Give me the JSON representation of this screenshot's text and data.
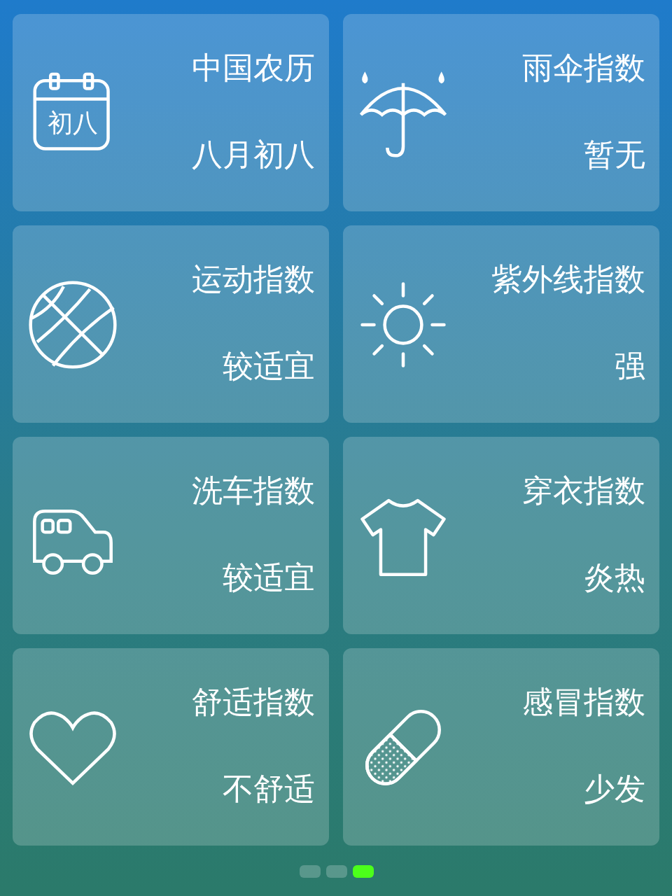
{
  "cards": [
    {
      "kind": "calendar",
      "icon_text": "初八",
      "title": "中国农历",
      "value": "八月初八"
    },
    {
      "kind": "umbrella",
      "title": "雨伞指数",
      "value": "暂无"
    },
    {
      "kind": "ball",
      "title": "运动指数",
      "value": "较适宜"
    },
    {
      "kind": "sun",
      "title": "紫外线指数",
      "value": "强"
    },
    {
      "kind": "car",
      "title": "洗车指数",
      "value": "较适宜"
    },
    {
      "kind": "shirt",
      "title": "穿衣指数",
      "value": "炎热"
    },
    {
      "kind": "heart",
      "title": "舒适指数",
      "value": "不舒适"
    },
    {
      "kind": "pill",
      "title": "感冒指数",
      "value": "少发"
    }
  ],
  "pages": [
    {
      "selected": false
    },
    {
      "selected": false
    },
    {
      "selected": true
    }
  ]
}
